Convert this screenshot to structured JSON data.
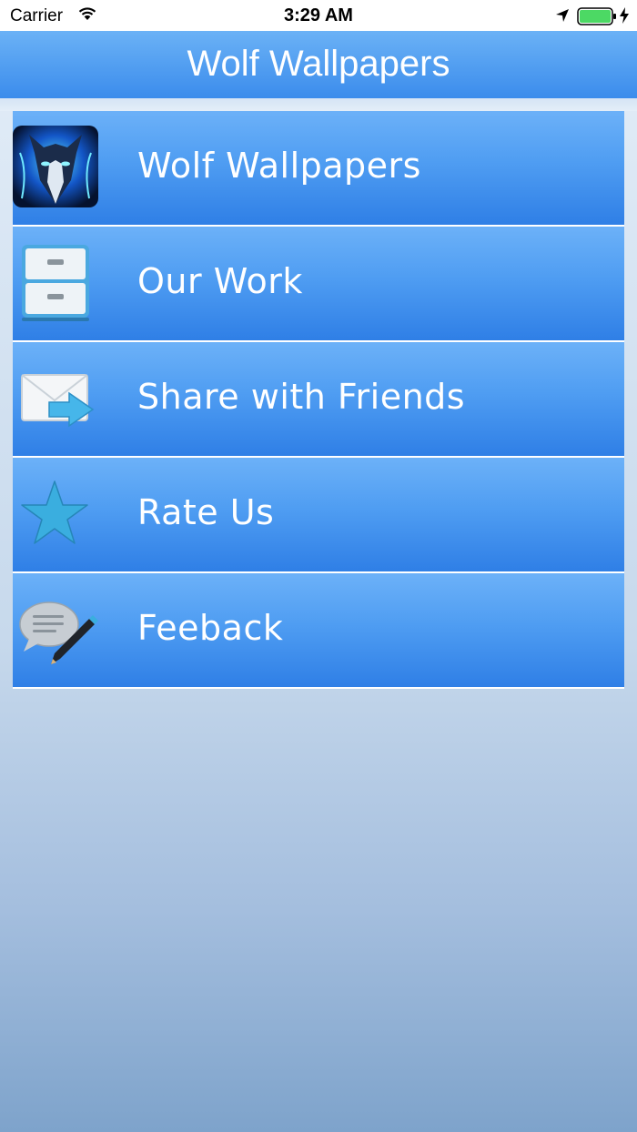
{
  "status_bar": {
    "carrier": "Carrier",
    "time": "3:29 AM",
    "battery_color": "#4cd964"
  },
  "nav": {
    "title": "Wolf Wallpapers"
  },
  "menu": {
    "items": [
      {
        "label": "Wolf Wallpapers",
        "icon": "wolf-icon"
      },
      {
        "label": "Our Work",
        "icon": "cabinet-icon"
      },
      {
        "label": "Share with Friends",
        "icon": "mail-forward-icon"
      },
      {
        "label": "Rate Us",
        "icon": "star-icon"
      },
      {
        "label": "Feeback",
        "icon": "chat-pencil-icon"
      }
    ]
  },
  "colors": {
    "bar_top": "#6bb2f6",
    "bar_bottom": "#3b8cec",
    "row_top": "#6cb1f8",
    "row_bottom": "#2f7fe6"
  }
}
